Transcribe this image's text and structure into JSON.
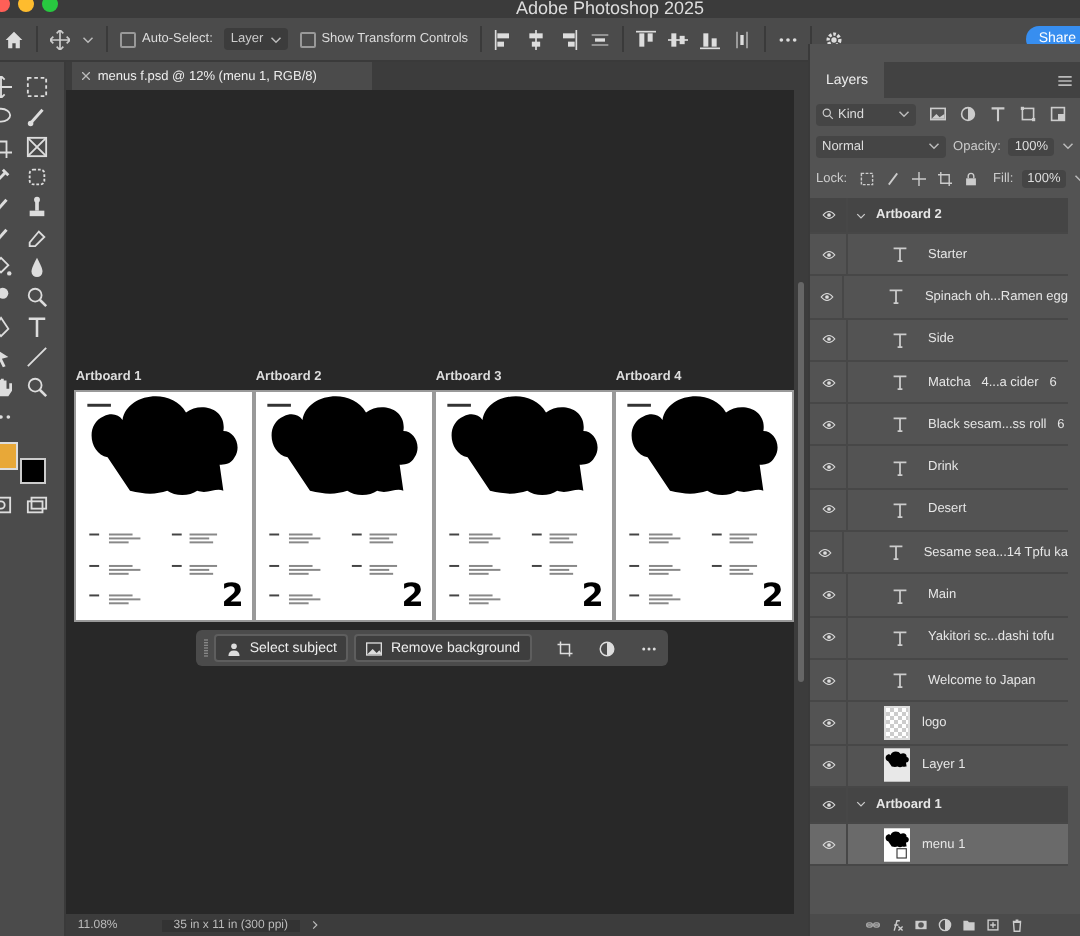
{
  "window": {
    "title": "Adobe Photoshop 2025"
  },
  "options_bar": {
    "auto_select": {
      "label": "Auto-Select:",
      "checked": false
    },
    "target": "Layer",
    "transform_controls": {
      "label": "Show Transform Controls",
      "checked": false
    },
    "share": "Share"
  },
  "document_tab": {
    "title": "menus f.psd @ 12% (menu 1, RGB/8)"
  },
  "artboards": [
    {
      "label": "Artboard 1",
      "logo": "2"
    },
    {
      "label": "Artboard 2",
      "logo": "2"
    },
    {
      "label": "Artboard 3",
      "logo": "2"
    },
    {
      "label": "Artboard 4",
      "logo": "2"
    }
  ],
  "contextual_bar": {
    "buttons": [
      {
        "label": "Select subject",
        "kind": "subject"
      },
      {
        "label": "Remove background",
        "kind": "background"
      }
    ]
  },
  "status_bar": {
    "zoom": "11.08%",
    "size": "35 in x 11 in (300 ppi)"
  },
  "layers_panel": {
    "tab": "Layers",
    "filter": "Kind",
    "blend_mode": "Normal",
    "opacity_label": "Opacity:",
    "opacity": "100%",
    "lock_label": "Lock:",
    "fill_label": "Fill:",
    "fill": "100%",
    "layers": [
      {
        "name": "Artboard 2",
        "kind": "artboard",
        "expanded": true,
        "visible": true,
        "selected": false,
        "children": [
          {
            "name": "Starter",
            "kind": "text",
            "visible": true,
            "selected": false
          },
          {
            "name": "Spinach oh...Ramen egg",
            "kind": "text",
            "visible": true,
            "selected": false
          },
          {
            "name": "Side",
            "kind": "text",
            "visible": true,
            "selected": false
          },
          {
            "name": "Matcha   4...a cider   6",
            "kind": "text",
            "visible": true,
            "selected": false
          },
          {
            "name": "Black sesam...ss roll   6",
            "kind": "text",
            "visible": true,
            "selected": false
          },
          {
            "name": "Drink",
            "kind": "text",
            "visible": true,
            "selected": false
          },
          {
            "name": "Desert",
            "kind": "text",
            "visible": true,
            "selected": false
          },
          {
            "name": "Sesame sea...14 Tpfu ka",
            "kind": "text",
            "visible": true,
            "selected": false
          },
          {
            "name": "Main",
            "kind": "text",
            "visible": true,
            "selected": false
          },
          {
            "name": "Yakitori sc...dashi tofu",
            "kind": "text",
            "visible": true,
            "selected": false
          },
          {
            "name": "Welcome to Japan",
            "kind": "text",
            "visible": true,
            "selected": false
          },
          {
            "name": "logo",
            "kind": "blank",
            "visible": true,
            "selected": false
          },
          {
            "name": "Layer 1",
            "kind": "shape",
            "visible": true,
            "selected": false
          }
        ]
      },
      {
        "name": "Artboard 1",
        "kind": "artboard",
        "expanded": true,
        "visible": true,
        "selected": false,
        "children": [
          {
            "name": "menu 1",
            "kind": "smart",
            "visible": true,
            "selected": true
          }
        ]
      }
    ]
  }
}
